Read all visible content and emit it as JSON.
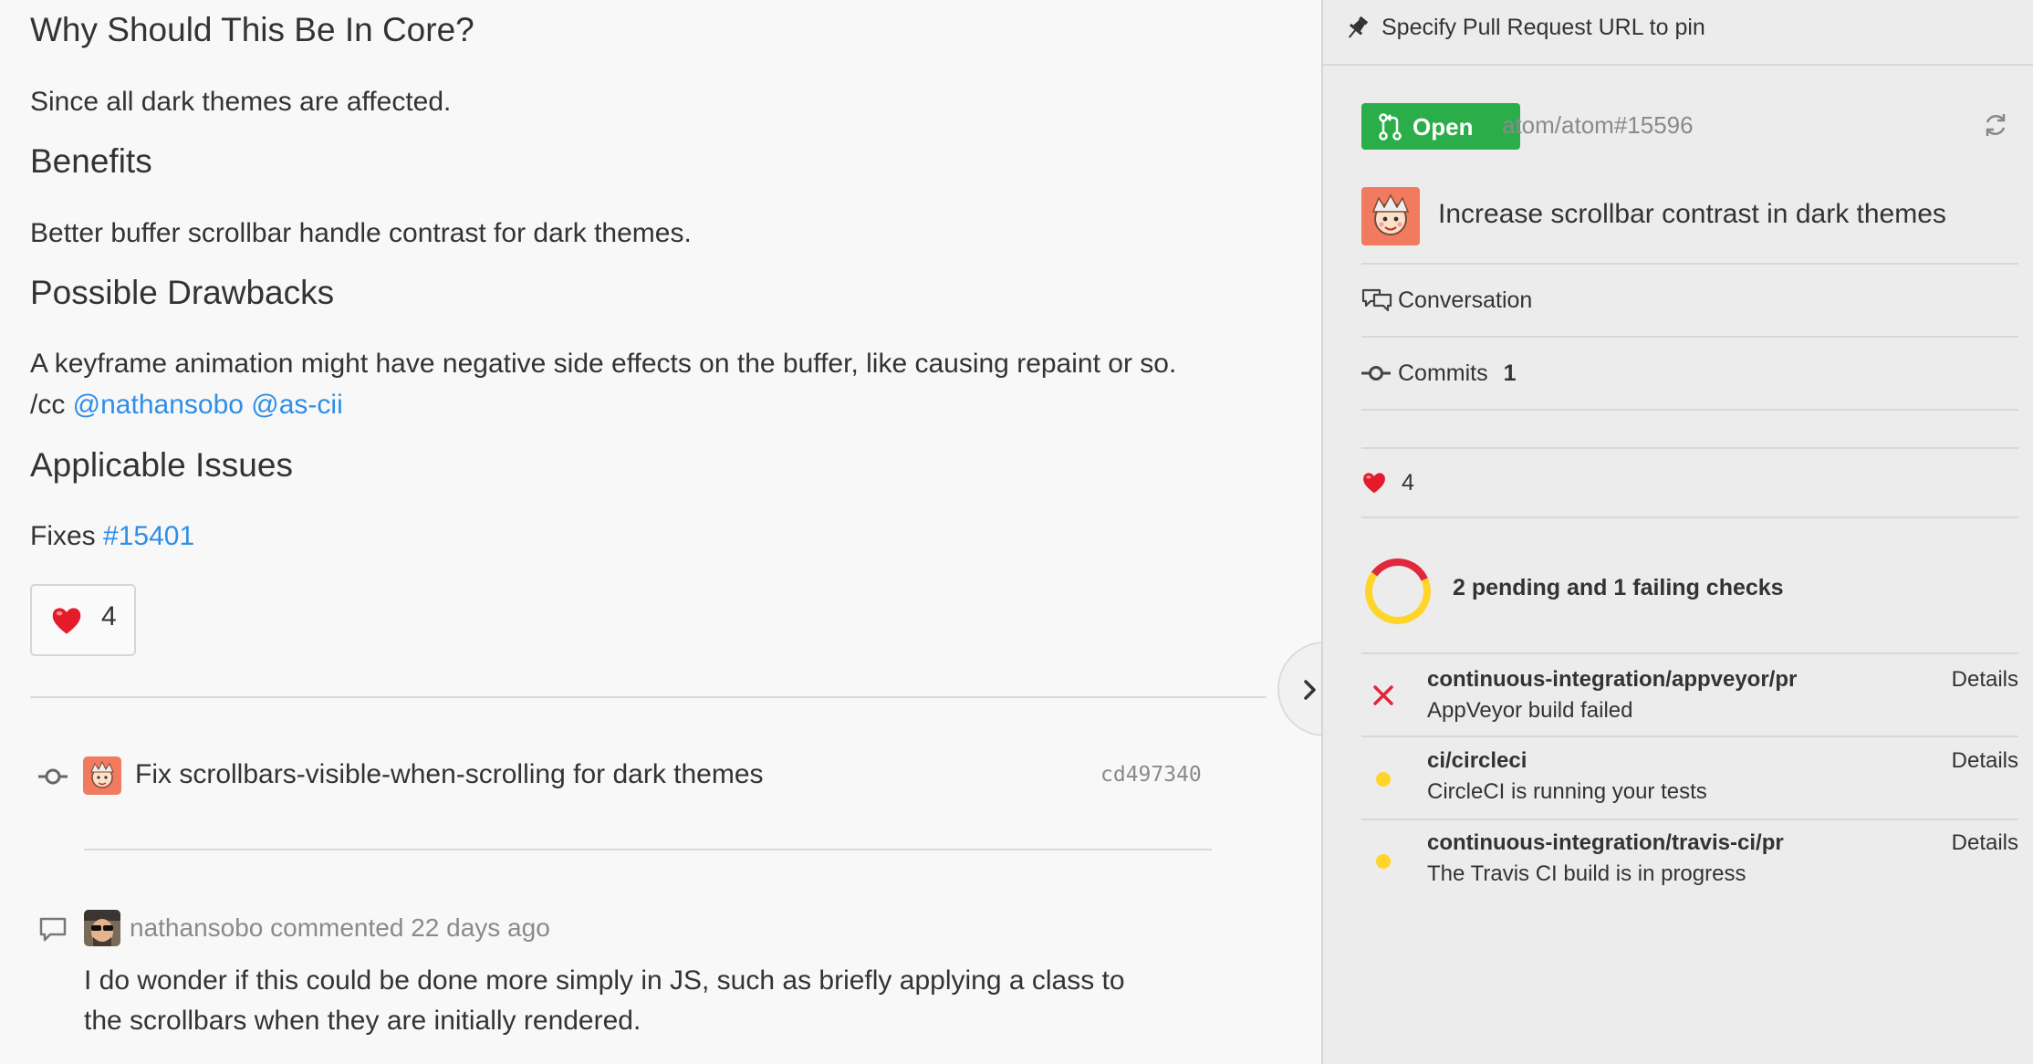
{
  "body": {
    "h_why": "Why Should This Be In Core?",
    "p_why": "Since all dark themes are affected.",
    "h_benefits": "Benefits",
    "p_benefits": "Better buffer scrollbar handle contrast for dark themes.",
    "h_drawbacks": "Possible Drawbacks",
    "p_drawbacks": "A keyframe animation might have negative side effects on the buffer, like causing repaint or so.",
    "cc_prefix": "/cc ",
    "mention_1": "@nathansobo",
    "mention_2": "@as-cii",
    "h_issues": "Applicable Issues",
    "fixes_prefix": "Fixes ",
    "fixes_link": "#15401"
  },
  "reaction": {
    "icon": "heart-icon",
    "count": "4"
  },
  "commit": {
    "message": "Fix scrollbars-visible-when-scrolling for dark themes",
    "sha": "cd497340"
  },
  "comment": {
    "author": "nathansobo",
    "meta": "commented 22 days ago",
    "line1": "I do wonder if this could be done more simply in JS, such as briefly applying a class to",
    "line2": "the scrollbars when they are initially rendered."
  },
  "sidebar": {
    "pin_label": "Specify Pull Request URL to pin",
    "status": "Open",
    "pr_ref": "atom/atom#15596",
    "pr_title": "Increase scrollbar contrast in dark themes",
    "tab_conversation": "Conversation",
    "tab_commits": "Commits",
    "commits_count": "1",
    "reaction_count": "4",
    "checks_summary": "2 pending and 1 failing checks",
    "checks": [
      {
        "context": "continuous-integration/appveyor/pr",
        "description": "AppVeyor build failed",
        "state": "failure",
        "details": "Details"
      },
      {
        "context": "ci/circleci",
        "description": "CircleCI is running your tests",
        "state": "pending",
        "details": "Details"
      },
      {
        "context": "continuous-integration/travis-ci/pr",
        "description": "The Travis CI build is in progress",
        "state": "pending",
        "details": "Details"
      }
    ],
    "donut": {
      "failing": 1,
      "pending": 2
    }
  },
  "colors": {
    "open_green": "#2bae4a",
    "link_blue": "#2f8ee8",
    "fail_red": "#e0283c",
    "pending_yellow": "#ffd52a"
  }
}
